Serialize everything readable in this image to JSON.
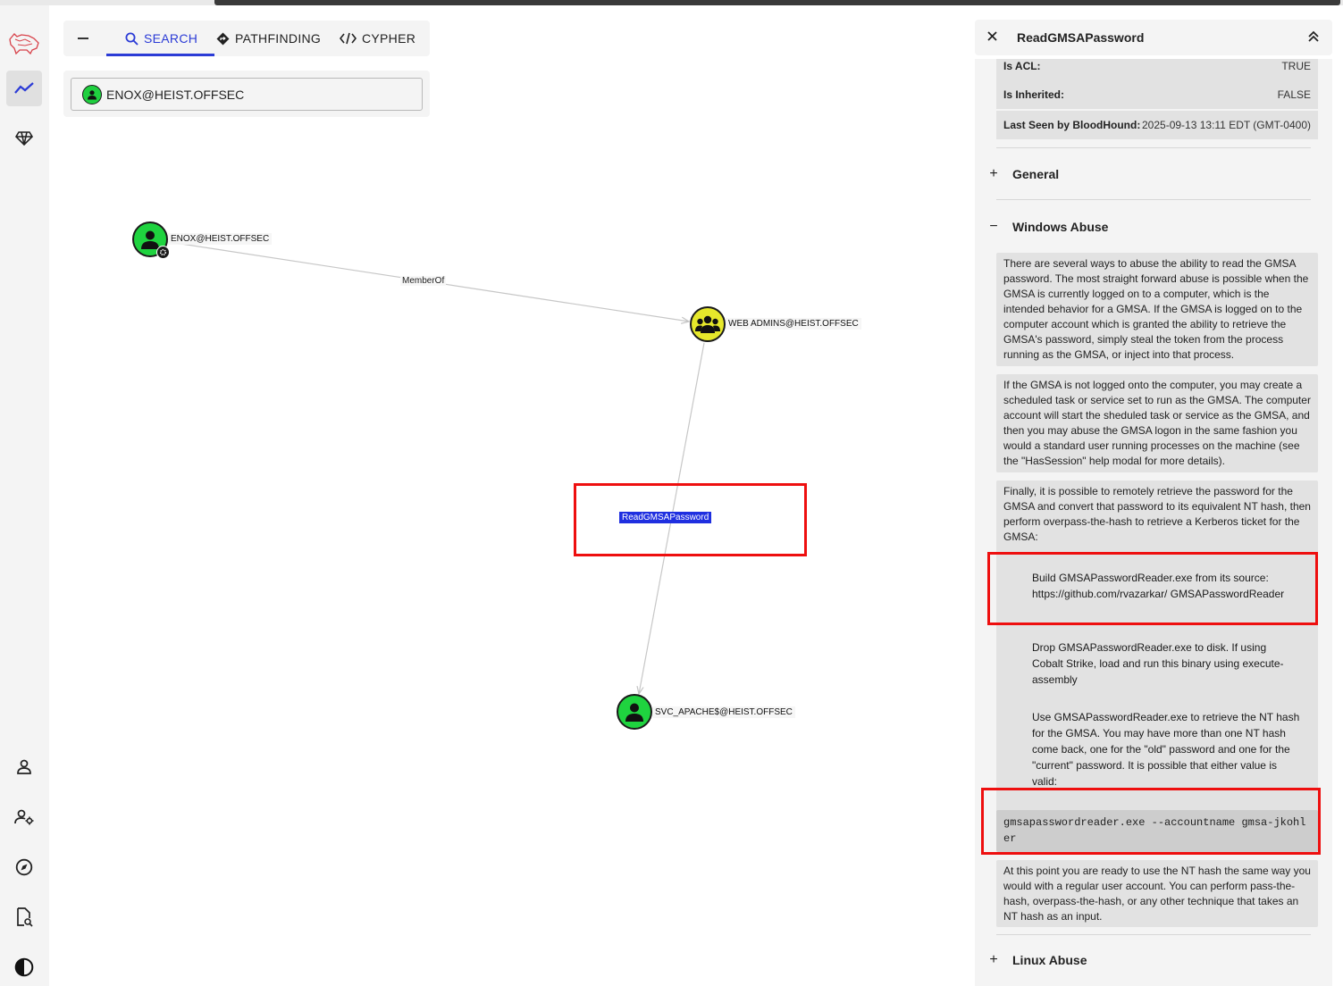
{
  "search_panel": {
    "tabs": [
      {
        "label": "SEARCH",
        "icon": "search-icon",
        "active": true
      },
      {
        "label": "PATHFINDING",
        "icon": "pathfinding-icon",
        "active": false
      },
      {
        "label": "CYPHER",
        "icon": "code-icon",
        "active": false
      }
    ],
    "search_value": "ENOX@HEIST.OFFSEC"
  },
  "graph": {
    "nodes": [
      {
        "label": "ENOX@HEIST.OFFSEC",
        "type": "user",
        "badge": "owned"
      },
      {
        "label": "WEB ADMINS@HEIST.OFFSEC",
        "type": "group"
      },
      {
        "label": "SVC_APACHE$@HEIST.OFFSEC",
        "type": "user"
      }
    ],
    "edges": [
      {
        "label": "MemberOf",
        "selected": false
      },
      {
        "label": "ReadGMSAPassword",
        "selected": true
      }
    ]
  },
  "panel": {
    "title": "ReadGMSAPassword",
    "properties": [
      {
        "key": "Is ACL:",
        "value": "TRUE"
      },
      {
        "key": "Is Inherited:",
        "value": "FALSE"
      },
      {
        "key": "Last Seen by BloodHound:",
        "value": "2025-09-13 13:11 EDT (GMT-0400)"
      }
    ],
    "sections": {
      "general": "General",
      "windows_abuse": "Windows Abuse",
      "linux_abuse": "Linux Abuse"
    },
    "windows_abuse": {
      "p1": "There are several ways to abuse the ability to read the GMSA password. The most straight forward abuse is possible when the GMSA is currently logged on to a computer, which is the intended behavior for a GMSA. If the GMSA is logged on to the computer account which is granted the ability to retrieve the GMSA's password, simply steal the token from the process running as the GMSA, or inject into that process.",
      "p2": "If the GMSA is not logged onto the computer, you may create a scheduled task or service set to run as the GMSA. The computer account will start the sheduled task or service as the GMSA, and then you may abuse the GMSA logon in the same fashion you would a standard user running processes on the machine (see the \"HasSession\" help modal for more details).",
      "p3": "Finally, it is possible to remotely retrieve the password for the GMSA and convert that password to its equivalent NT hash, then perform overpass-the-hash to retrieve a Kerberos ticket for the GMSA:",
      "step1": "Build GMSAPasswordReader.exe from its source: https://github.com/rvazarkar/ GMSAPasswordReader",
      "step2": "Drop GMSAPasswordReader.exe to disk. If using Cobalt Strike, load and run this binary using execute-assembly",
      "step3": "Use GMSAPasswordReader.exe to retrieve the NT hash for the GMSA. You may have more than one NT hash come back, one for the \"old\" password and one for the \"current\" password. It is possible that either value is valid:",
      "command": "gmsapasswordreader.exe --accountname gmsa-jkohler",
      "p4": "At this point you are ready to use the NT hash the same way you would with a regular user account. You can perform pass-the-hash, overpass-the-hash, or any other technique that takes an NT hash as an input."
    }
  },
  "colors": {
    "accent": "#2b3bd6",
    "user_node": "#1fd33f",
    "group_node": "#e6e82b",
    "highlight_box": "#ee0f0f",
    "selected_edge": "#1f2fe0"
  }
}
